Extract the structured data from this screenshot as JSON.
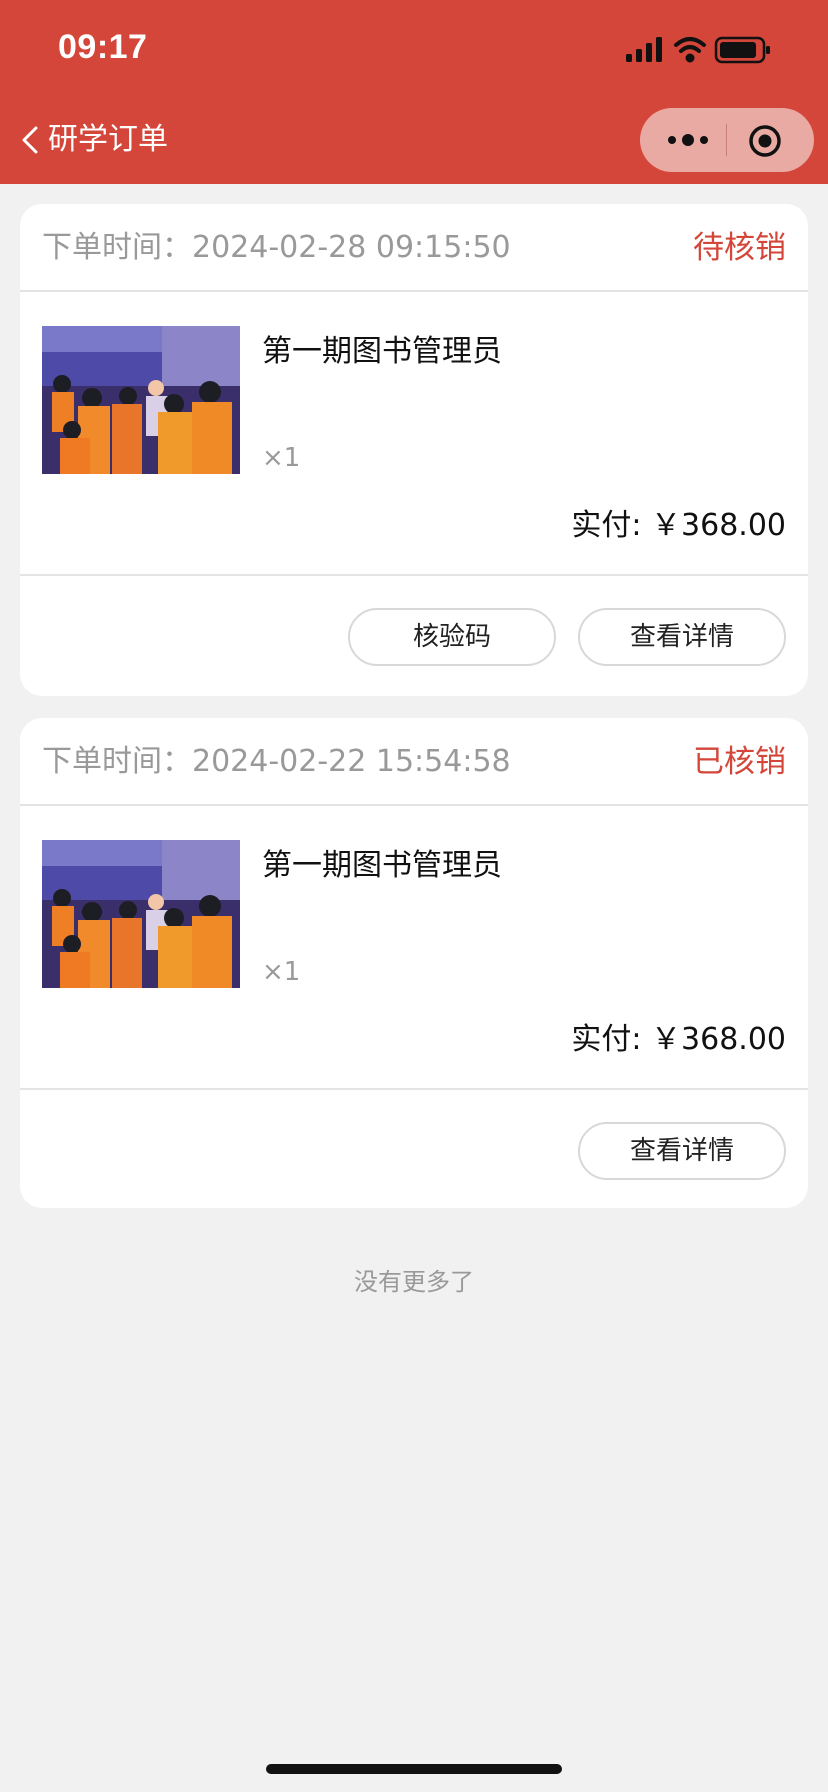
{
  "status_bar": {
    "time": "09:17"
  },
  "nav": {
    "title": "研学订单"
  },
  "orders": [
    {
      "time_label": "下单时间：",
      "time_value": "2024-02-28 09:15:50",
      "status": "待核销",
      "product_name": "第一期图书管理员",
      "quantity": "×1",
      "paid": "实付: ￥368.00",
      "buttons": [
        "核验码",
        "查看详情"
      ]
    },
    {
      "time_label": "下单时间：",
      "time_value": "2024-02-22 15:54:58",
      "status": "已核销",
      "product_name": "第一期图书管理员",
      "quantity": "×1",
      "paid": "实付: ￥368.00",
      "buttons": [
        "查看详情"
      ]
    }
  ],
  "footer": {
    "no_more": "没有更多了"
  },
  "colors": {
    "header": "#d5463a",
    "status_text": "#d5463a",
    "background": "#f1f1f1"
  },
  "icons": [
    "back-chevron-icon",
    "signal-icon",
    "wifi-icon",
    "battery-icon",
    "more-dots-icon",
    "target-close-icon"
  ]
}
